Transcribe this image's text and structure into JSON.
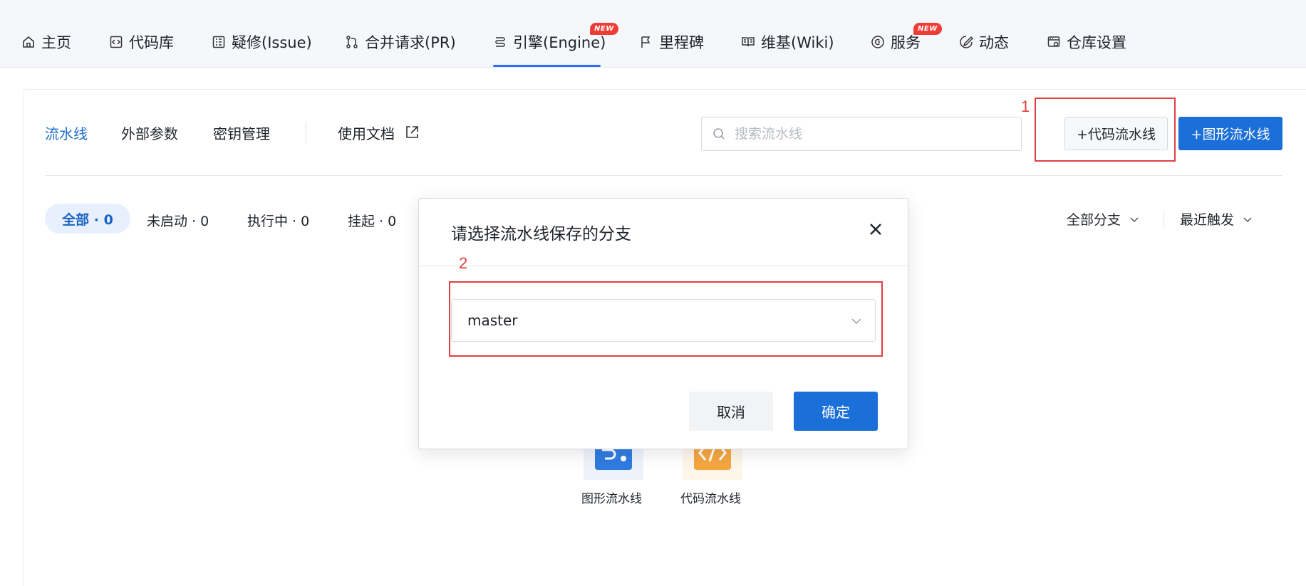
{
  "nav": {
    "items": [
      {
        "label": "主页",
        "icon": "home-icon"
      },
      {
        "label": "代码库",
        "icon": "code-repo-icon"
      },
      {
        "label": "疑修(Issue)",
        "icon": "issue-icon"
      },
      {
        "label": "合并请求(PR)",
        "icon": "pull-request-icon"
      },
      {
        "label": "引擎(Engine)",
        "icon": "engine-icon"
      },
      {
        "label": "里程碑",
        "icon": "flag-icon"
      },
      {
        "label": "维基(Wiki)",
        "icon": "book-icon"
      },
      {
        "label": "服务",
        "icon": "service-icon"
      },
      {
        "label": "动态",
        "icon": "activity-icon"
      },
      {
        "label": "仓库设置",
        "icon": "settings-icon"
      }
    ],
    "active_item": "引擎(Engine)",
    "new_badge": "NEW",
    "accent": "#2f6ef2"
  },
  "subtabs": {
    "pipeline": "流水线",
    "external_params": "外部参数",
    "secrets": "密钥管理",
    "docs": "使用文档"
  },
  "search": {
    "placeholder": "搜索流水线"
  },
  "buttons": {
    "code_pipeline": "+代码流水线",
    "graph_pipeline": "+图形流水线"
  },
  "annotations": {
    "first": "1",
    "second": "2",
    "color": "#e04040"
  },
  "filters": {
    "all": "全部 · 0",
    "not_started": "未启动 · 0",
    "running": "执行中 · 0",
    "suspended": "挂起 · 0"
  },
  "dropdowns": {
    "branch": "全部分支",
    "sort": "最近触发"
  },
  "empty_state": {
    "graph_label": "图形流水线",
    "code_label": "代码流水线"
  },
  "modal": {
    "title": "请选择流水线保存的分支",
    "branch_value": "master",
    "cancel": "取消",
    "confirm": "确定"
  },
  "colors": {
    "primary": "#1a6fd8",
    "active_text": "#1f6fc8"
  }
}
